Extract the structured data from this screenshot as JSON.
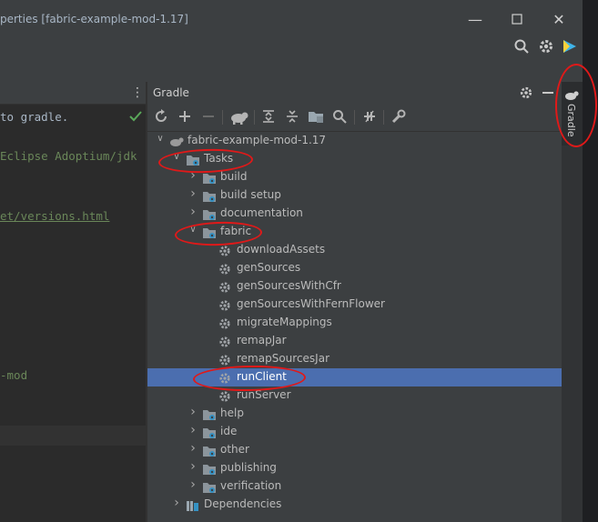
{
  "window": {
    "title": "perties [fabric-example-mod-1.17]",
    "minimize_icon": "minimize-icon",
    "maximize_icon": "maximize-icon",
    "close_icon": "close-icon"
  },
  "editor": {
    "lines": [
      " to gradle.",
      "Eclipse Adoptium/jdk",
      "et/versions.html",
      "-mod"
    ]
  },
  "gradle": {
    "title": "Gradle",
    "side_tab_label": "Gradle",
    "toolbar_icons": [
      "refresh-icon",
      "add-icon",
      "remove-icon",
      "elephant-icon",
      "expand-all-icon",
      "collapse-all-icon",
      "group-modules-icon",
      "search-icon",
      "toggle-offline-icon",
      "settings-wrench-icon"
    ],
    "tree": {
      "root": "fabric-example-mod-1.17",
      "tasks_label": "Tasks",
      "groups_before": [
        "build",
        "build setup",
        "documentation"
      ],
      "fabric_label": "fabric",
      "fabric_tasks": [
        "downloadAssets",
        "genSources",
        "genSourcesWithCfr",
        "genSourcesWithFernFlower",
        "migrateMappings",
        "remapJar",
        "remapSourcesJar",
        "runClient",
        "runServer"
      ],
      "selected_task": "runClient",
      "groups_after": [
        "help",
        "ide",
        "other",
        "publishing",
        "verification"
      ],
      "dependencies_label": "Dependencies"
    }
  },
  "colors": {
    "selection": "#4b6eaf",
    "annotation": "#e01919",
    "checkmark": "#5aa85a",
    "code_green": "#6a8759"
  }
}
